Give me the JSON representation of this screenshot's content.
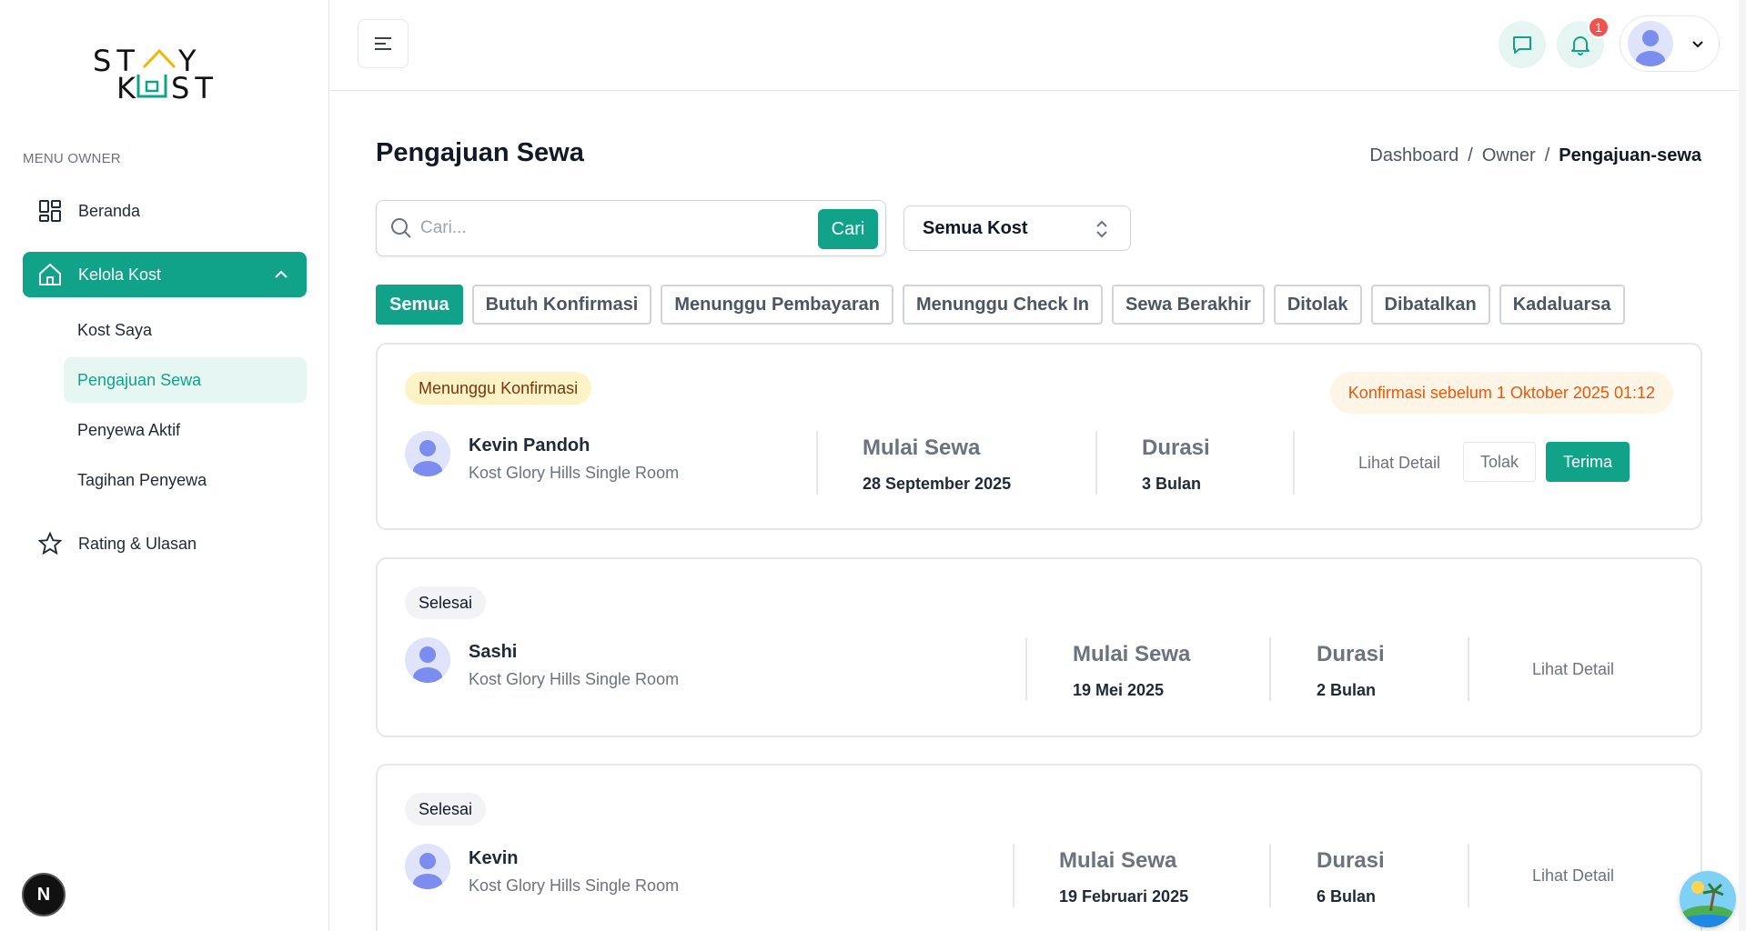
{
  "brand": {
    "logo_top": "ST Y",
    "logo_bottom": "K ST",
    "accent": "#10a38a"
  },
  "sidebar": {
    "menu_title": "MENU OWNER",
    "items": [
      {
        "label": "Beranda",
        "icon": "dashboard-grid-icon"
      },
      {
        "label": "Kelola Kost",
        "icon": "home-icon",
        "expanded": true
      },
      {
        "label": "Rating & Ulasan",
        "icon": "star-icon"
      }
    ],
    "sub_items": [
      {
        "label": "Kost Saya"
      },
      {
        "label": "Pengajuan Sewa",
        "active": true
      },
      {
        "label": "Penyewa Aktif"
      },
      {
        "label": "Tagihan Penyewa"
      }
    ],
    "next_badge": "N"
  },
  "topbar": {
    "notification_count": "1",
    "icons": [
      "menu-icon",
      "chat-icon",
      "bell-icon",
      "avatar",
      "chevron-down-icon"
    ]
  },
  "main": {
    "title": "Pengajuan Sewa",
    "breadcrumb": [
      "Dashboard",
      "/",
      "Owner",
      "/",
      "Pengajuan-sewa"
    ],
    "search": {
      "placeholder": "Cari...",
      "button": "Cari"
    },
    "kost_filter": "Semua Kost",
    "tabs": [
      "Semua",
      "Butuh Konfirmasi",
      "Menunggu Pembayaran",
      "Menunggu Check In",
      "Sewa Berakhir",
      "Ditolak",
      "Dibatalkan",
      "Kadaluarsa"
    ],
    "active_tab": "Semua",
    "cards": [
      {
        "status": "Menunggu Konfirmasi",
        "deadline": "Konfirmasi sebelum 1 Oktober 2025 01:12",
        "name": "Kevin Pandoh",
        "room": "Kost Glory Hills Single Room",
        "start_label": "Mulai Sewa",
        "start_value": "28 September 2025",
        "duration_label": "Durasi",
        "duration_value": "3 Bulan",
        "detail": "Lihat Detail",
        "reject": "Tolak",
        "accept": "Terima"
      },
      {
        "status": "Selesai",
        "name": "Sashi",
        "room": "Kost Glory Hills Single Room",
        "start_label": "Mulai Sewa",
        "start_value": "19 Mei 2025",
        "duration_label": "Durasi",
        "duration_value": "2 Bulan",
        "detail": "Lihat Detail"
      },
      {
        "status": "Selesai",
        "name": "Kevin",
        "room": "Kost Glory Hills Single Room",
        "start_label": "Mulai Sewa",
        "start_value": "19 Februari 2025",
        "duration_label": "Durasi",
        "duration_value": "6 Bulan",
        "detail": "Lihat Detail"
      }
    ]
  }
}
